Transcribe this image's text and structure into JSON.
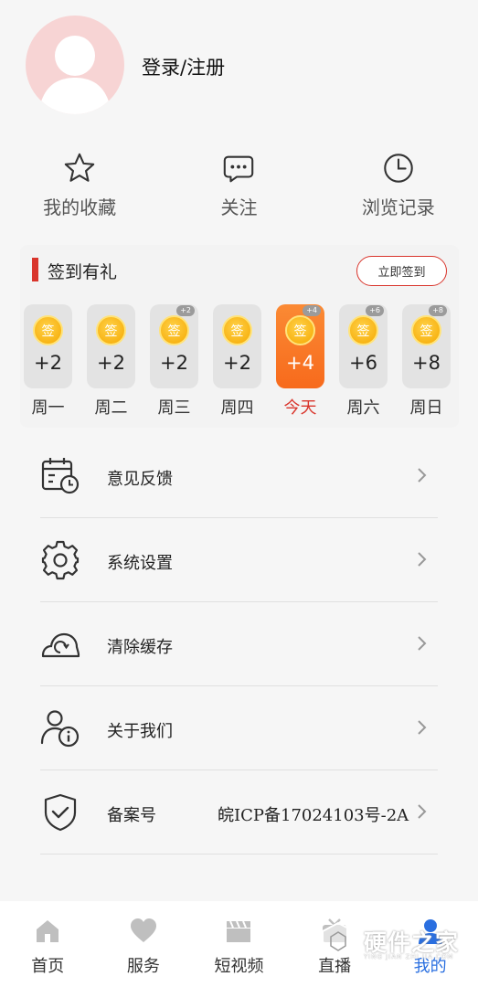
{
  "profile": {
    "login_label": "登录/注册"
  },
  "quick_actions": [
    {
      "label": "我的收藏",
      "icon": "star-icon"
    },
    {
      "label": "关注",
      "icon": "chat-bubble-icon"
    },
    {
      "label": "浏览记录",
      "icon": "clock-icon"
    }
  ],
  "signin": {
    "title": "签到有礼",
    "button_label": "立即签到",
    "accent_color": "#d9352c",
    "days": [
      {
        "day": "周一",
        "points": "+2",
        "coin": "签",
        "badge": ""
      },
      {
        "day": "周二",
        "points": "+2",
        "coin": "签",
        "badge": ""
      },
      {
        "day": "周三",
        "points": "+2",
        "coin": "签",
        "badge": "+2"
      },
      {
        "day": "周四",
        "points": "+2",
        "coin": "签",
        "badge": ""
      },
      {
        "day": "今天",
        "points": "+4",
        "coin": "签",
        "badge": "+4",
        "today": true
      },
      {
        "day": "周六",
        "points": "+6",
        "coin": "签",
        "badge": "+6"
      },
      {
        "day": "周日",
        "points": "+8",
        "coin": "签",
        "badge": "+8"
      }
    ]
  },
  "menu": [
    {
      "label": "意见反馈",
      "icon": "calendar-clock-icon",
      "value": ""
    },
    {
      "label": "系统设置",
      "icon": "gear-icon",
      "value": ""
    },
    {
      "label": "清除缓存",
      "icon": "cloud-refresh-icon",
      "value": ""
    },
    {
      "label": "关于我们",
      "icon": "user-info-icon",
      "value": ""
    },
    {
      "label": "备案号",
      "icon": "shield-check-icon",
      "value": "皖ICP备17024103号-2A"
    }
  ],
  "tabbar": [
    {
      "label": "首页",
      "icon": "home-icon",
      "active": false
    },
    {
      "label": "服务",
      "icon": "heart-icon",
      "active": false
    },
    {
      "label": "短视频",
      "icon": "clapperboard-icon",
      "active": false
    },
    {
      "label": "直播",
      "icon": "live-icon",
      "active": false
    },
    {
      "label": "我的",
      "icon": "user-icon",
      "active": true
    }
  ],
  "watermark": {
    "text": "硬件之家",
    "sub": "YING JIAN ZHI JIA.COM"
  }
}
